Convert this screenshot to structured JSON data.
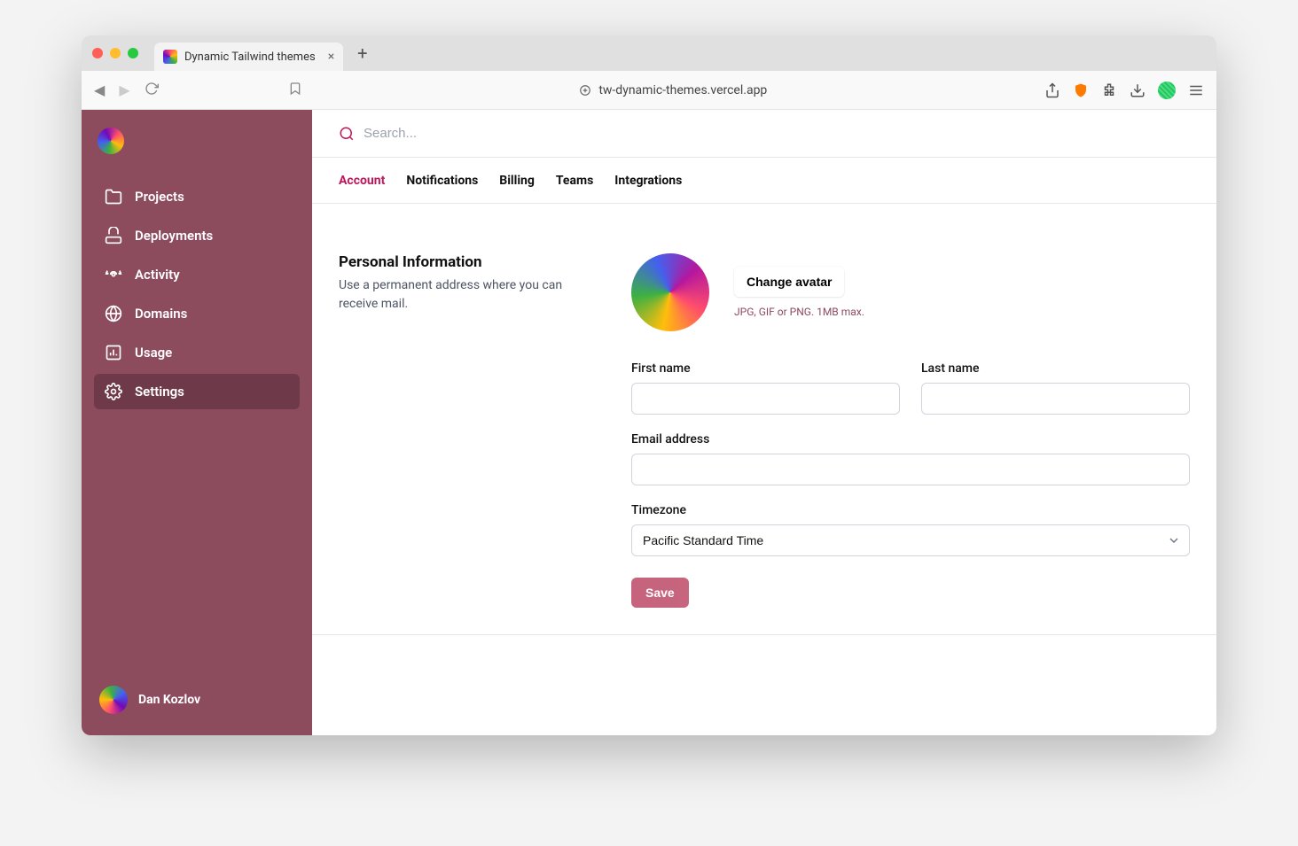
{
  "browser": {
    "tab_title": "Dynamic Tailwind themes",
    "url": "tw-dynamic-themes.vercel.app"
  },
  "sidebar": {
    "items": [
      {
        "label": "Projects"
      },
      {
        "label": "Deployments"
      },
      {
        "label": "Activity"
      },
      {
        "label": "Domains"
      },
      {
        "label": "Usage"
      },
      {
        "label": "Settings"
      }
    ],
    "user_name": "Dan Kozlov"
  },
  "search": {
    "placeholder": "Search..."
  },
  "tabs": [
    {
      "label": "Account"
    },
    {
      "label": "Notifications"
    },
    {
      "label": "Billing"
    },
    {
      "label": "Teams"
    },
    {
      "label": "Integrations"
    }
  ],
  "section": {
    "title": "Personal Information",
    "description": "Use a permanent address where you can receive mail.",
    "change_avatar_label": "Change avatar",
    "avatar_hint": "JPG, GIF or PNG. 1MB max.",
    "labels": {
      "first_name": "First name",
      "last_name": "Last name",
      "email": "Email address",
      "timezone": "Timezone"
    },
    "values": {
      "first_name": "",
      "last_name": "",
      "email": "",
      "timezone": "Pacific Standard Time"
    },
    "save_label": "Save"
  },
  "colors": {
    "sidebar_bg": "#8d4b5e",
    "accent": "#be185d"
  }
}
